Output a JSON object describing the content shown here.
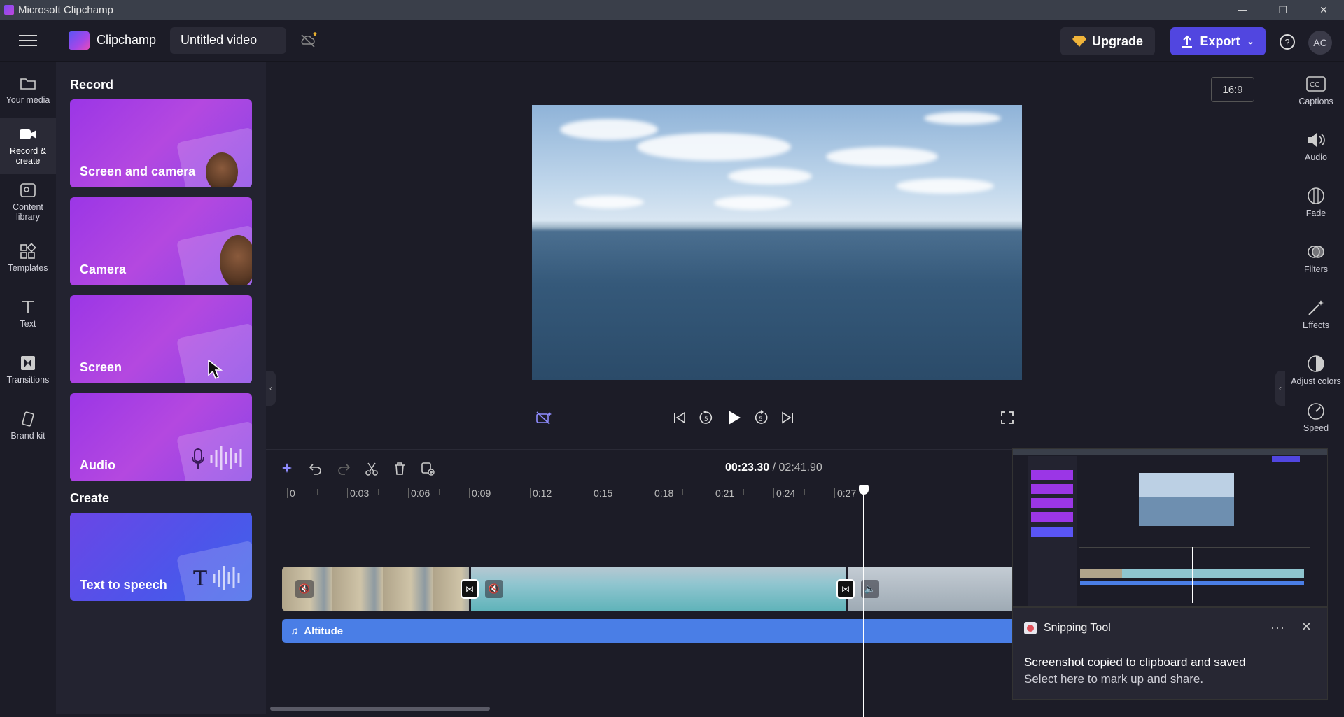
{
  "window": {
    "title": "Microsoft Clipchamp"
  },
  "header": {
    "brand": "Clipchamp",
    "video_title": "Untitled video",
    "upgrade_label": "Upgrade",
    "export_label": "Export",
    "help_label": "?",
    "avatar_initials": "AC"
  },
  "left_nav": [
    {
      "label": "Your media",
      "icon": "folder-icon"
    },
    {
      "label": "Record & create",
      "icon": "video-camera-icon",
      "active": true
    },
    {
      "label": "Content library",
      "icon": "library-icon"
    },
    {
      "label": "Templates",
      "icon": "templates-icon"
    },
    {
      "label": "Text",
      "icon": "text-icon"
    },
    {
      "label": "Transitions",
      "icon": "transitions-icon"
    },
    {
      "label": "Brand kit",
      "icon": "brand-kit-icon"
    }
  ],
  "panel": {
    "record_heading": "Record",
    "cards": [
      {
        "label": "Screen and camera"
      },
      {
        "label": "Camera"
      },
      {
        "label": "Screen"
      },
      {
        "label": "Audio"
      }
    ],
    "create_heading": "Create",
    "create_cards": [
      {
        "label": "Text to speech"
      }
    ]
  },
  "stage": {
    "aspect_ratio": "16:9"
  },
  "right_nav": [
    {
      "label": "Captions",
      "icon": "captions-icon"
    },
    {
      "label": "Audio",
      "icon": "speaker-icon"
    },
    {
      "label": "Fade",
      "icon": "fade-icon"
    },
    {
      "label": "Filters",
      "icon": "filters-icon"
    },
    {
      "label": "Effects",
      "icon": "magic-wand-icon"
    },
    {
      "label": "Adjust colors",
      "icon": "adjust-colors-icon"
    },
    {
      "label": "Speed",
      "icon": "speed-icon"
    }
  ],
  "timeline": {
    "current_time": "00:23.30",
    "total_time": "/ 02:41.90",
    "ticks": [
      "0",
      "0:03",
      "0:06",
      "0:09",
      "0:12",
      "0:15",
      "0:18",
      "0:21",
      "0:24",
      "0:27"
    ],
    "audio_track_label": "Altitude"
  },
  "toast": {
    "app_name": "Snipping Tool",
    "more_label": "···",
    "close_label": "✕",
    "message": "Screenshot copied to clipboard and saved",
    "sub_message": "Select here to mark up and share."
  },
  "colors": {
    "accent": "#5146e0",
    "audio_track": "#4a7ee6",
    "card_gradient": "#9b36e6"
  }
}
